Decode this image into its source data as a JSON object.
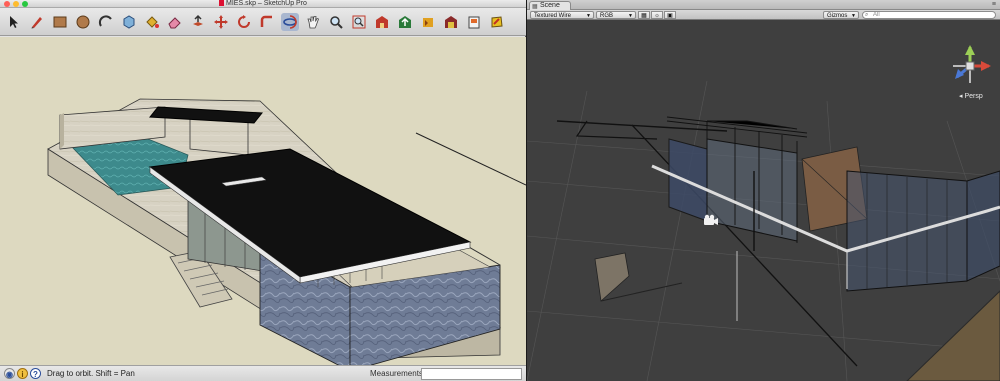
{
  "sketchup": {
    "window_title": "MIES.skp – SketchUp Pro",
    "toolbar": {
      "tools": [
        {
          "name": "select",
          "icon": "arrow-cursor-icon"
        },
        {
          "name": "line",
          "icon": "pencil-icon"
        },
        {
          "name": "rectangle",
          "icon": "rectangle-icon"
        },
        {
          "name": "circle",
          "icon": "circle-icon"
        },
        {
          "name": "arc",
          "icon": "arc-icon"
        },
        {
          "name": "make-component",
          "icon": "component-icon"
        },
        {
          "name": "paint-bucket",
          "icon": "paint-bucket-icon"
        },
        {
          "name": "eraser",
          "icon": "eraser-icon"
        },
        {
          "name": "push-pull",
          "icon": "push-pull-icon"
        },
        {
          "name": "move",
          "icon": "move-icon"
        },
        {
          "name": "rotate",
          "icon": "rotate-icon"
        },
        {
          "name": "follow-me",
          "icon": "follow-me-icon"
        },
        {
          "name": "orbit",
          "icon": "orbit-icon",
          "active": true
        },
        {
          "name": "pan",
          "icon": "hand-icon"
        },
        {
          "name": "zoom",
          "icon": "magnifier-icon"
        },
        {
          "name": "zoom-extents",
          "icon": "zoom-extents-icon"
        },
        {
          "name": "get-models",
          "icon": "warehouse-icon"
        },
        {
          "name": "share-model",
          "icon": "share-model-icon"
        },
        {
          "name": "get-photo-texture",
          "icon": "photo-texture-icon"
        },
        {
          "name": "extension-warehouse",
          "icon": "extension-warehouse-icon"
        },
        {
          "name": "layout",
          "icon": "layout-icon"
        },
        {
          "name": "style-builder",
          "icon": "style-icon"
        }
      ]
    },
    "status": {
      "hint": "Drag to orbit.  Shift = Pan",
      "measurements_label": "Measurements",
      "measurements_value": "",
      "geolocation_icon": "globe-icon",
      "credits_icon": "info-icon",
      "help_icon": "question-icon",
      "geolocation_glyph": "◉",
      "credits_glyph": "i",
      "help_glyph": "?"
    }
  },
  "unity": {
    "tab_label": "Scene",
    "tab_icon": "scene-icon",
    "draw_mode": "Textured Wire",
    "render_mode": "RGB",
    "toggle_2d_icon": "grid-icon",
    "toggle_light_icon": "sun-icon",
    "toggle_fx_icon": "image-icon",
    "gizmos_label": "Gizmos",
    "search_placeholder": "All",
    "projection_label": "Persp",
    "background_color": "#3f3f3f"
  },
  "colors": {
    "sketchup_background": "#ddd9c0",
    "roof": "#111111",
    "pool": "#3d8a8c",
    "travertine": "#d7d2c3",
    "marble_wall": "#6f7c96"
  }
}
